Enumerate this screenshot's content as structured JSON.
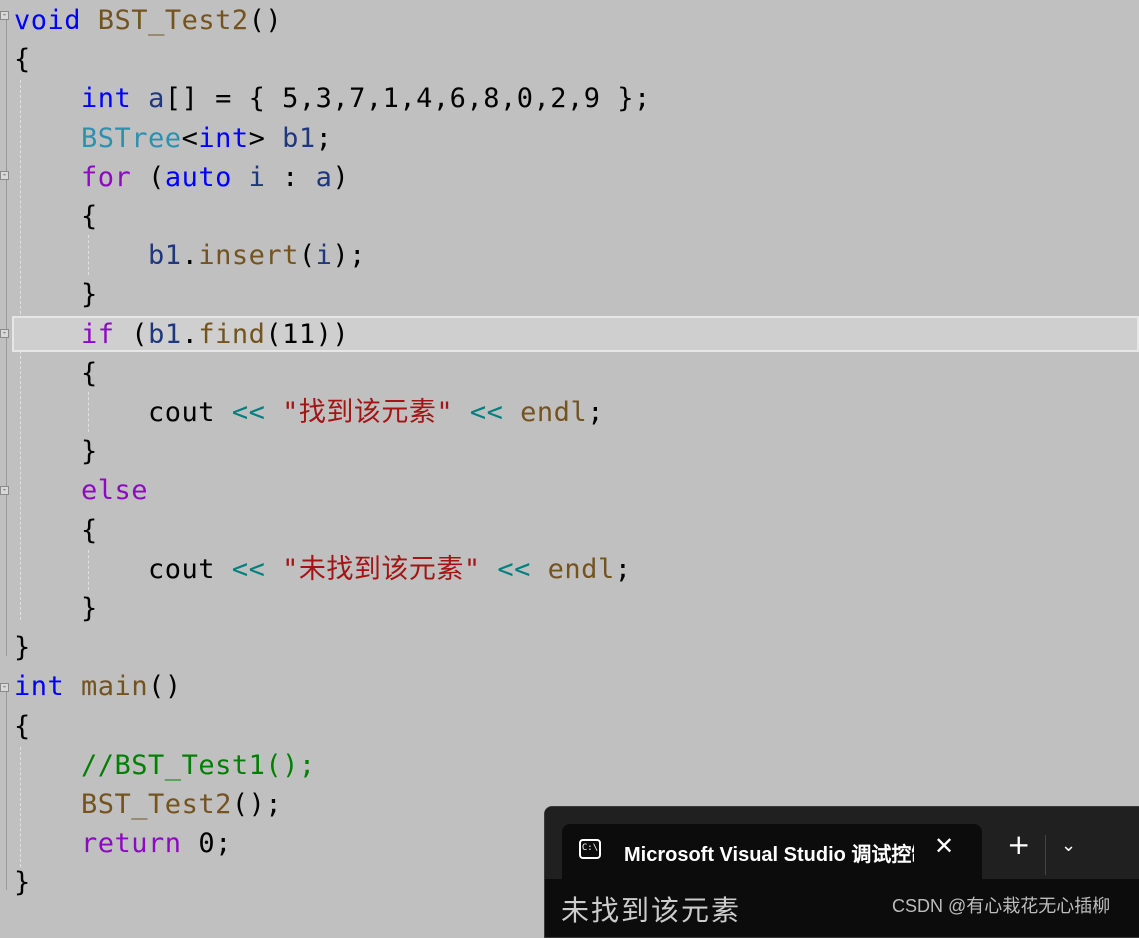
{
  "editor": {
    "lines": [
      {
        "tokens": [
          {
            "c": "kw",
            "t": "void"
          },
          {
            "c": "",
            "t": " "
          },
          {
            "c": "fn",
            "t": "BST_Test2"
          },
          {
            "c": "",
            "t": "()"
          }
        ]
      },
      {
        "tokens": [
          {
            "c": "",
            "t": "{"
          }
        ]
      },
      {
        "tokens": [
          {
            "c": "",
            "t": "    "
          },
          {
            "c": "kw",
            "t": "int"
          },
          {
            "c": "",
            "t": " "
          },
          {
            "c": "var",
            "t": "a"
          },
          {
            "c": "",
            "t": "[] = { 5,3,7,1,4,6,8,0,2,9 };"
          }
        ]
      },
      {
        "tokens": [
          {
            "c": "",
            "t": "    "
          },
          {
            "c": "ty",
            "t": "BSTree"
          },
          {
            "c": "",
            "t": "<"
          },
          {
            "c": "kw",
            "t": "int"
          },
          {
            "c": "",
            "t": "> "
          },
          {
            "c": "var",
            "t": "b1"
          },
          {
            "c": "",
            "t": ";"
          }
        ]
      },
      {
        "tokens": [
          {
            "c": "",
            "t": "    "
          },
          {
            "c": "ctl",
            "t": "for"
          },
          {
            "c": "",
            "t": " ("
          },
          {
            "c": "kw",
            "t": "auto"
          },
          {
            "c": "",
            "t": " "
          },
          {
            "c": "var",
            "t": "i"
          },
          {
            "c": "",
            "t": " : "
          },
          {
            "c": "var",
            "t": "a"
          },
          {
            "c": "",
            "t": ")"
          }
        ]
      },
      {
        "tokens": [
          {
            "c": "",
            "t": "    {"
          }
        ]
      },
      {
        "tokens": [
          {
            "c": "",
            "t": "        "
          },
          {
            "c": "var",
            "t": "b1"
          },
          {
            "c": "",
            "t": "."
          },
          {
            "c": "fn",
            "t": "insert"
          },
          {
            "c": "",
            "t": "("
          },
          {
            "c": "var",
            "t": "i"
          },
          {
            "c": "",
            "t": ");"
          }
        ]
      },
      {
        "tokens": [
          {
            "c": "",
            "t": "    }"
          }
        ]
      },
      {
        "tokens": [
          {
            "c": "",
            "t": "    "
          },
          {
            "c": "ctl",
            "t": "if"
          },
          {
            "c": "",
            "t": " ("
          },
          {
            "c": "var",
            "t": "b1"
          },
          {
            "c": "",
            "t": "."
          },
          {
            "c": "fn",
            "t": "find"
          },
          {
            "c": "",
            "t": "(11))"
          }
        ]
      },
      {
        "tokens": [
          {
            "c": "",
            "t": "    {"
          }
        ]
      },
      {
        "tokens": [
          {
            "c": "",
            "t": "        cout "
          },
          {
            "c": "op",
            "t": "<<"
          },
          {
            "c": "",
            "t": " "
          },
          {
            "c": "str",
            "t": "\"找到该元素\""
          },
          {
            "c": "",
            "t": " "
          },
          {
            "c": "op",
            "t": "<<"
          },
          {
            "c": "",
            "t": " "
          },
          {
            "c": "fn",
            "t": "endl"
          },
          {
            "c": "",
            "t": ";"
          }
        ]
      },
      {
        "tokens": [
          {
            "c": "",
            "t": "    }"
          }
        ]
      },
      {
        "tokens": [
          {
            "c": "",
            "t": "    "
          },
          {
            "c": "ctl",
            "t": "else"
          }
        ]
      },
      {
        "tokens": [
          {
            "c": "",
            "t": "    {"
          }
        ]
      },
      {
        "tokens": [
          {
            "c": "",
            "t": "        cout "
          },
          {
            "c": "op",
            "t": "<<"
          },
          {
            "c": "",
            "t": " "
          },
          {
            "c": "str",
            "t": "\"未找到该元素\""
          },
          {
            "c": "",
            "t": " "
          },
          {
            "c": "op",
            "t": "<<"
          },
          {
            "c": "",
            "t": " "
          },
          {
            "c": "fn",
            "t": "endl"
          },
          {
            "c": "",
            "t": ";"
          }
        ]
      },
      {
        "tokens": [
          {
            "c": "",
            "t": "    }"
          }
        ]
      },
      {
        "tokens": [
          {
            "c": "",
            "t": "}"
          }
        ]
      },
      {
        "tokens": [
          {
            "c": "kw",
            "t": "int"
          },
          {
            "c": "",
            "t": " "
          },
          {
            "c": "fn",
            "t": "main"
          },
          {
            "c": "",
            "t": "()"
          }
        ]
      },
      {
        "tokens": [
          {
            "c": "",
            "t": "{"
          }
        ]
      },
      {
        "tokens": [
          {
            "c": "",
            "t": "    "
          },
          {
            "c": "cmt",
            "t": "//BST_Test1();"
          }
        ]
      },
      {
        "tokens": [
          {
            "c": "",
            "t": "    "
          },
          {
            "c": "fn",
            "t": "BST_Test2"
          },
          {
            "c": "",
            "t": "();"
          }
        ]
      },
      {
        "tokens": [
          {
            "c": "",
            "t": "    "
          },
          {
            "c": "ctl",
            "t": "return"
          },
          {
            "c": "",
            "t": " 0;"
          }
        ]
      },
      {
        "tokens": [
          {
            "c": "",
            "t": "}"
          }
        ]
      }
    ],
    "current_line": 9
  },
  "terminal": {
    "tab_icon": "console-icon",
    "tab_icon_text": "C:\\",
    "tab_title": "Microsoft Visual Studio 调试控制台",
    "close_glyph": "✕",
    "new_tab_glyph": "+",
    "dropdown_glyph": "⌄",
    "output": "未找到该元素"
  },
  "watermark": "CSDN @有心栽花无心插柳"
}
